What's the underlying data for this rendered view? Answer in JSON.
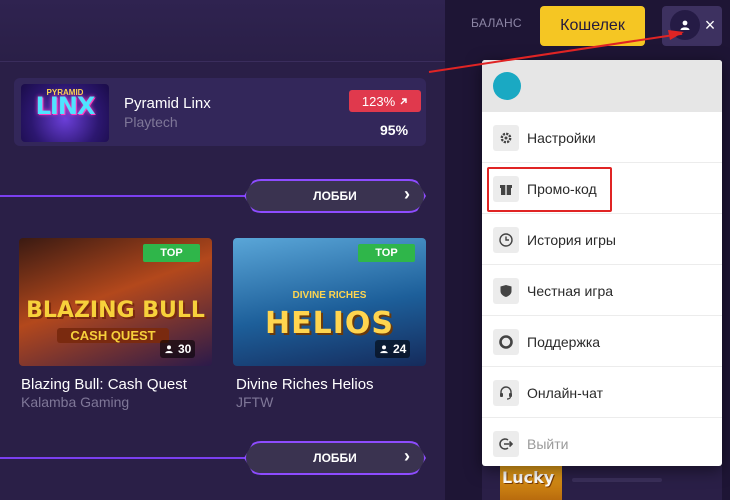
{
  "header": {
    "balance_label": "БАЛАНС",
    "wallet_label": "Кошелек",
    "close_symbol": "×"
  },
  "featured_game": {
    "name": "Pyramid Linx",
    "provider": "Playtech",
    "change_pct": "123%",
    "rtp": "95%",
    "thumb_top": "PYRAMID",
    "thumb_logo": "LINX"
  },
  "lobby_button_label": "ЛОББИ",
  "games": [
    {
      "title": "Blazing Bull: Cash Quest",
      "provider": "Kalamba Gaming",
      "badge": "TOP",
      "players": "30",
      "art_main": "BLAZING BULL",
      "art_sub": "CASH QUEST"
    },
    {
      "title": "Divine Riches Helios",
      "provider": "JFTW",
      "badge": "TOP",
      "players": "24",
      "art_main": "HELIOS",
      "art_sub": "DIVINE RICHES"
    }
  ],
  "user_menu": {
    "items": [
      {
        "label": "Настройки",
        "icon": "gear-icon"
      },
      {
        "label": "Промо-код",
        "icon": "gift-icon"
      },
      {
        "label": "История игры",
        "icon": "clock-icon"
      },
      {
        "label": "Честная игра",
        "icon": "shield-icon"
      },
      {
        "label": "Поддержка",
        "icon": "lifebuoy-icon"
      },
      {
        "label": "Онлайн-чат",
        "icon": "headset-icon"
      },
      {
        "label": "Выйти",
        "icon": "logout-icon"
      }
    ]
  },
  "side_game_thumb": "Lucky",
  "colors": {
    "accent_yellow": "#f5c623",
    "badge_red": "#e0394d",
    "badge_green": "#2fb64a",
    "lobby_border": "#8d4cff",
    "annotation_red": "#e02424"
  }
}
